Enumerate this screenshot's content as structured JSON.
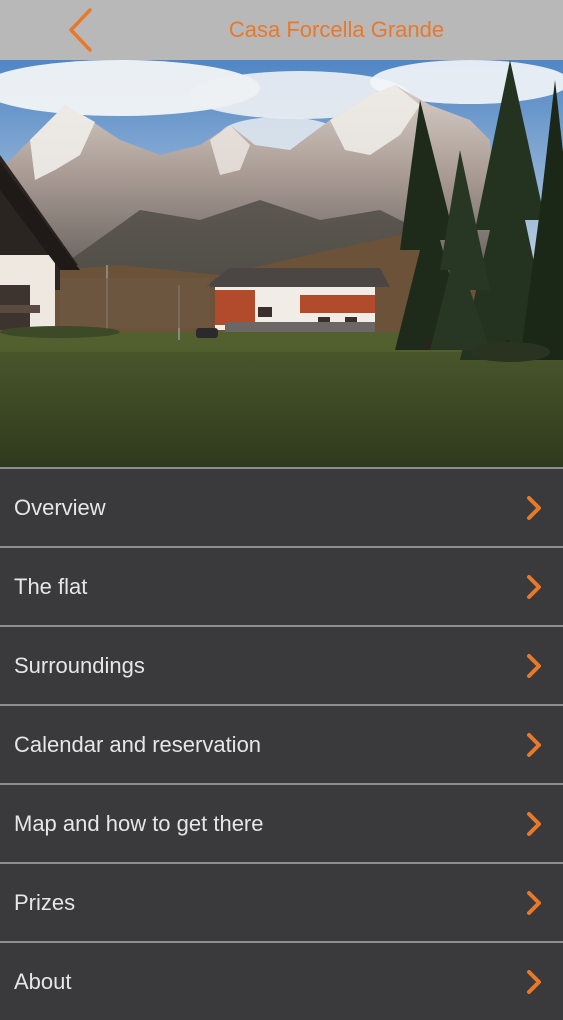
{
  "header": {
    "title": "Casa Forcella Grande",
    "back_icon": "chevron-left-icon"
  },
  "colors": {
    "accent": "#e8792b",
    "header_bg": "#b8b8b8",
    "menu_bg": "#3a393b",
    "menu_text": "#e6e6e6",
    "divider": "#8f8e90"
  },
  "hero": {
    "image": "mountain-chalet-photo"
  },
  "menu": {
    "items": [
      {
        "label": "Overview",
        "icon": "chevron-right-icon"
      },
      {
        "label": "The flat",
        "icon": "chevron-right-icon"
      },
      {
        "label": "Surroundings",
        "icon": "chevron-right-icon"
      },
      {
        "label": "Calendar and reservation",
        "icon": "chevron-right-icon"
      },
      {
        "label": "Map and how to get there",
        "icon": "chevron-right-icon"
      },
      {
        "label": "Prizes",
        "icon": "chevron-right-icon"
      },
      {
        "label": "About",
        "icon": "chevron-right-icon"
      }
    ]
  }
}
